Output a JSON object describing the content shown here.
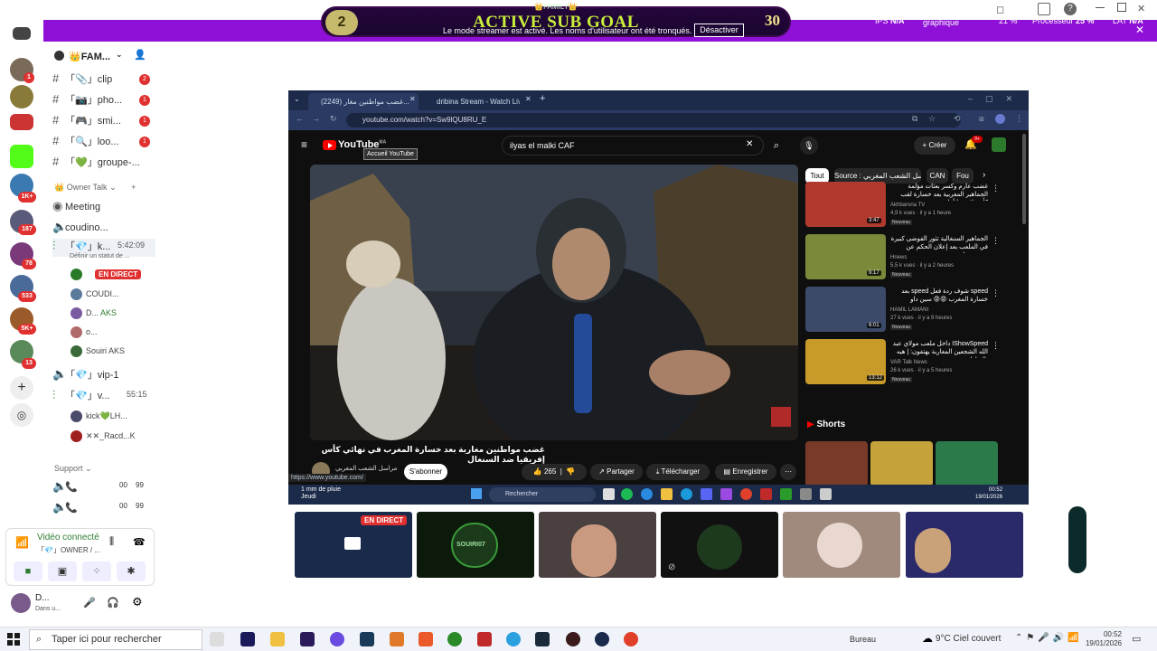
{
  "overlay": {
    "family_label": "👑FAMILY👑",
    "goal_title": "ACTIVE SUB GOAL",
    "goal_current": "2",
    "goal_target": "30",
    "streamer_note": "Le mode streamer est activé. Les noms d'utilisateur ont été tronqués.",
    "disable_button": "Désactiver",
    "ips_label": "IPS",
    "ips_value": "N/A",
    "gpu_label": "Processeur graphique",
    "gpu_value": "21 %",
    "cpu_label": "Processeur",
    "cpu_value": "25 %",
    "lat_label": "LAT",
    "lat_value": "N/A"
  },
  "rail": {
    "badges": [
      "1",
      "187",
      "78",
      "533",
      "5K+",
      "13",
      "1K+"
    ]
  },
  "sidebar": {
    "server_name": "👑FAM...",
    "channels": [
      {
        "label": "「📎」clip",
        "badge": "2"
      },
      {
        "label": "「📷」pho...",
        "badge": "1"
      },
      {
        "label": "「🎮」smi...",
        "badge": "1"
      },
      {
        "label": "「🔍」loo...",
        "badge": "1"
      },
      {
        "label": "「💚」groupe-...",
        "badge": ""
      }
    ],
    "owner_category": "👑 Owner Talk",
    "meeting": "Meeting",
    "voice_channel_1": "coudino...",
    "voice_channel_2": "「💎」k...",
    "voice_time_2": "5:42:09",
    "voice_status": "Définir un statut de ...",
    "live_label": "EN DIRECT",
    "voice_users": [
      "COUDI...",
      "D...",
      "o...",
      "Souiri"
    ],
    "aks_label": "AKS",
    "vip_channel": "「💎」vip-1",
    "voice_channel_3": "「💎」v...",
    "voice_time_3": "55:15",
    "voice_users_3": [
      "kick💚LH...",
      "✕✕_Racd...K"
    ],
    "support_category": "Support",
    "support_counts": [
      "00",
      "99"
    ]
  },
  "voice_panel": {
    "title": "Vidéo connecté",
    "subtitle": "「💎」OWNER / ...",
    "user_name": "D...",
    "user_status": "Dans u..."
  },
  "browser": {
    "tab1": "(2249) غضب مواطنين مغار...",
    "tab2": "dribina Stream - Watch Live on",
    "url": "youtube.com/watch?v=Sw9lQU8RU_E"
  },
  "youtube": {
    "logo": "YouTube",
    "logo_region": "MA",
    "tooltip": "Accueil YouTube",
    "search_value": "ilyas el malki  CAF",
    "create_label": "Créer",
    "notif_count": "9+",
    "video_title": "غضب مواطنين مغاربة بعد خسارة المغرب في نهائي كأس إفريقيا ضد السنغال",
    "channel_name": "مراسل الشعب المغربي",
    "subscribe_label": "S'abonner",
    "likes": "265",
    "share_label": "Partager",
    "download_label": "Télécharger",
    "save_label": "Enregistrer",
    "status_url": "https://www.youtube.com/",
    "chips": [
      "Tout",
      "Source : مراسل الشعب المغربي",
      "CAN",
      "Fou"
    ],
    "recommendations": [
      {
        "title": "غضب عارم وكسر بعثات مؤلمة الجماهير المغربية بعد خسارة لقب كأس إفريقيا أمام ...",
        "channel": "Akhbarona TV",
        "meta": "4,9 k vues · il y a 1 heure",
        "duration": "3:47",
        "badge": "Nouveau",
        "color": "#b03a2e"
      },
      {
        "title": "الجماهير السنغالية تثور الفوضى كبيرة في الملعب بعد إعلان الحكم عن ضربة جزاء ...",
        "channel": "Hnews",
        "meta": "5,5 k vues · il y a 2 heures",
        "duration": "9:17",
        "badge": "Nouveau",
        "color": "#7a8a3a"
      },
      {
        "title": "speed شوف ردة فعل speed بعد خسارة المغرب 😡😡 سين داو",
        "channel": "HAMIL LAMANI",
        "meta": "27 k vues · il y a 9 heures",
        "duration": "6:01",
        "badge": "Nouveau",
        "color": "#3c4a6a"
      },
      {
        "title": "IShowSpeed داخل ملعب مولاي عبد الله الشجعين المغاربة يهتفون: | هيه بالرباط ...",
        "channel": "VAR Talk News",
        "meta": "26 k vues · il y a 5 heures",
        "duration": "13:12",
        "badge": "Nouveau",
        "color": "#c79a2a"
      }
    ],
    "shorts_title": "Shorts"
  },
  "inner_taskbar": {
    "weather": "1 mm de pluie",
    "weather_day": "Jeudi",
    "search": "Rechercher",
    "time": "00:52",
    "date": "19/01/2026"
  },
  "streams": {
    "live_label": "EN DIRECT",
    "tile_name": "SOUIRI07"
  },
  "taskbar": {
    "search_placeholder": "Taper ici pour rechercher",
    "bureau": "Bureau",
    "weather": "9°C  Ciel couvert",
    "time": "00:52",
    "date": "19/01/2026"
  }
}
